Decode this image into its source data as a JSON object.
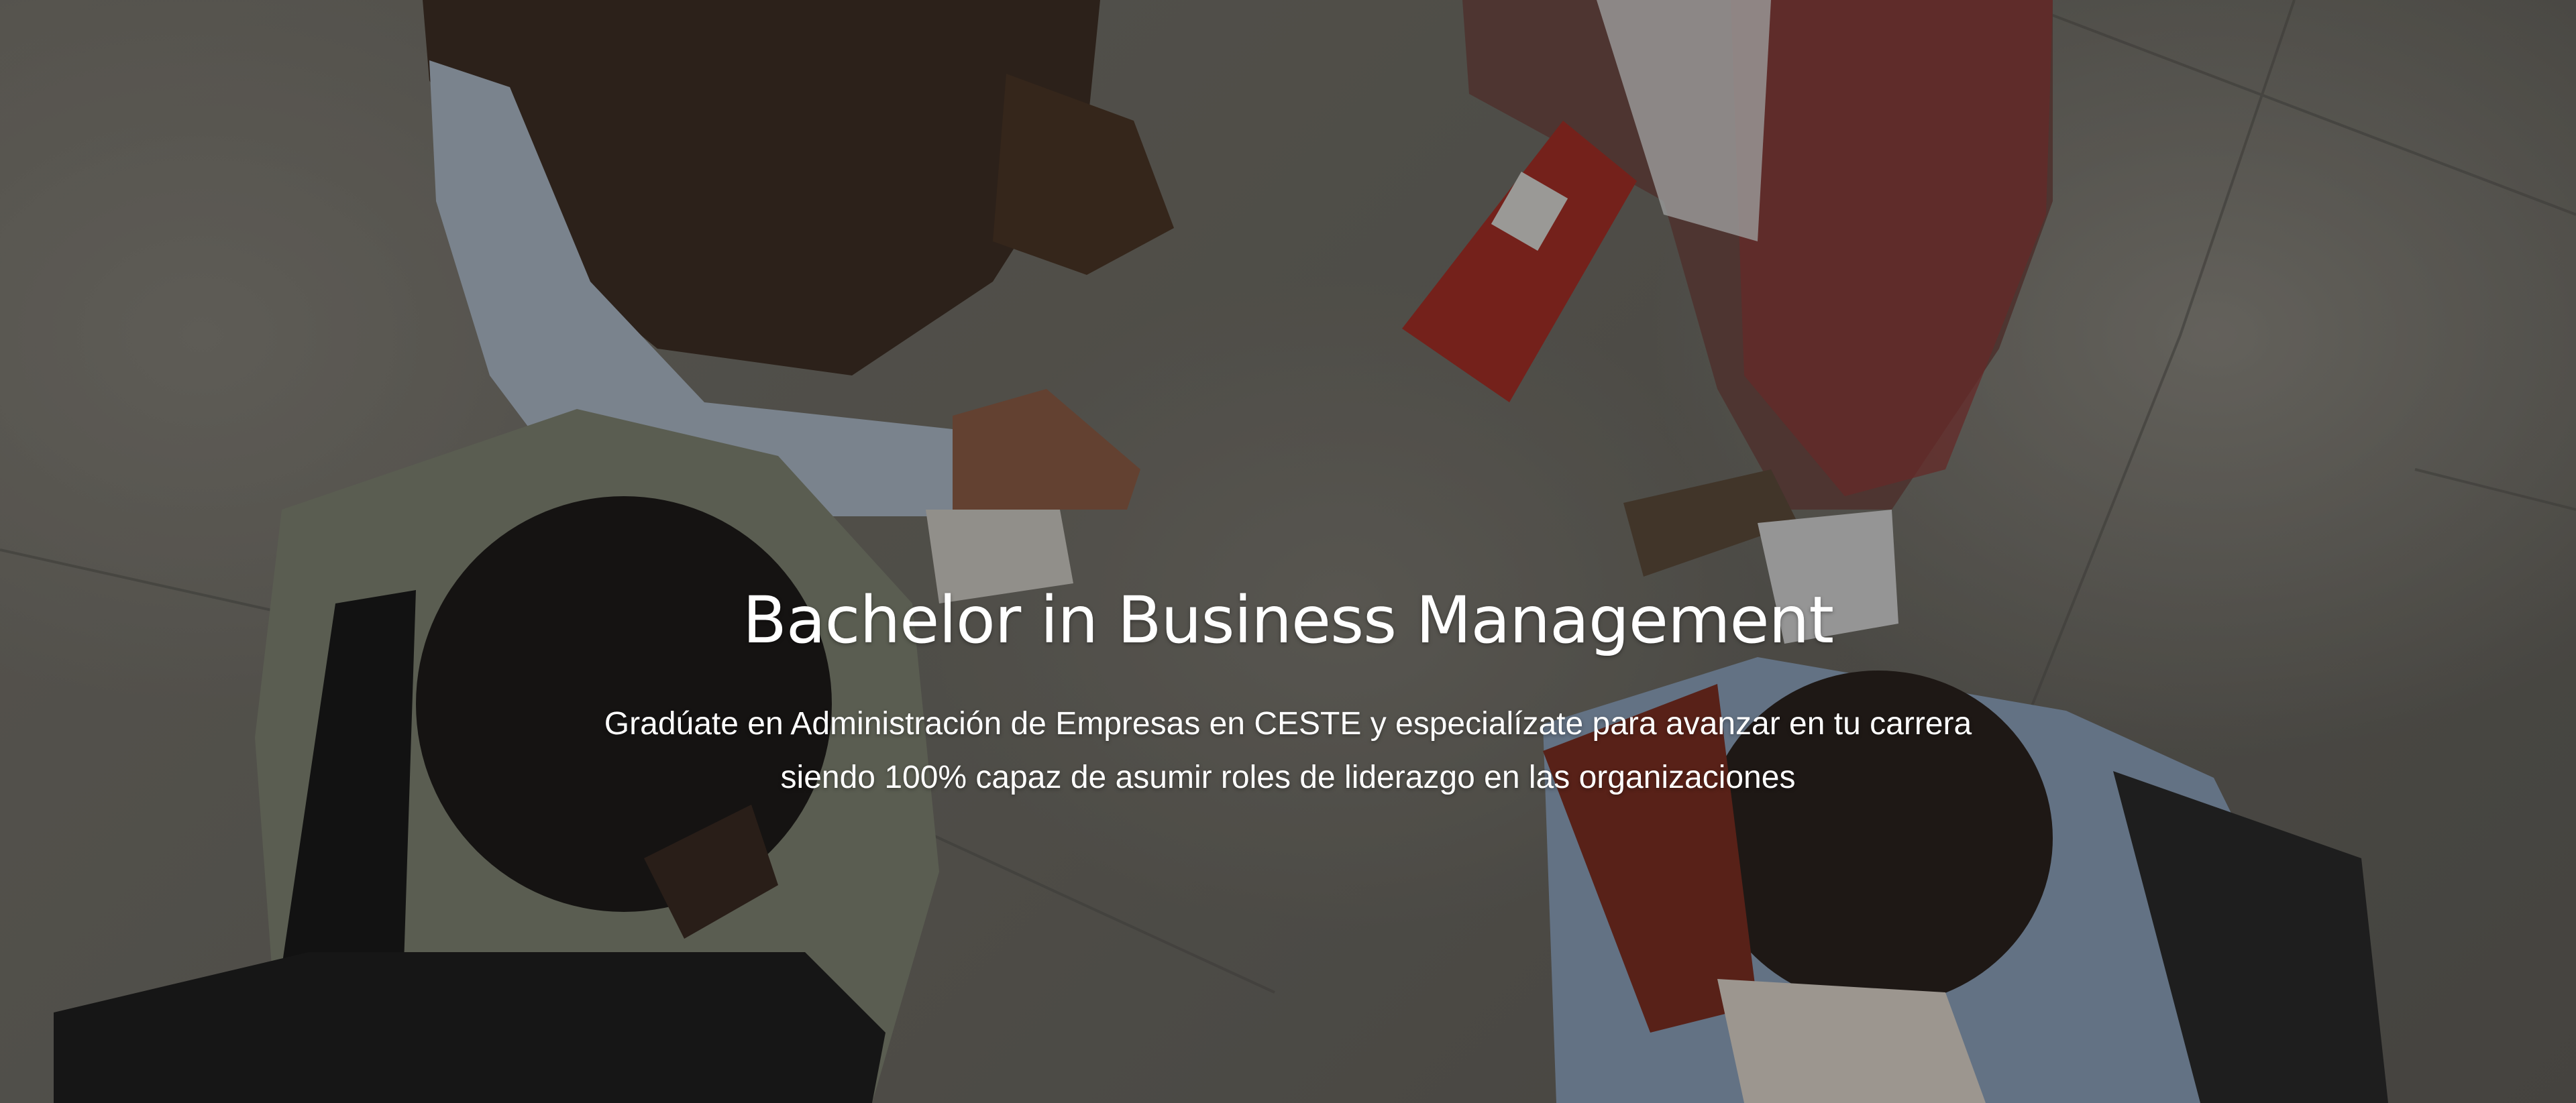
{
  "hero": {
    "title": "Bachelor in Business Management",
    "subtitle_line1": "Gradúate en Administración de Empresas en CESTE y especialízate para avanzar en tu carrera",
    "subtitle_line2": "siendo 100% capaz de asumir roles de liderazgo en las organizaciones",
    "background_image": "students-top-view-photo"
  },
  "colors": {
    "text": "#ffffff",
    "floor": "#77746c",
    "overlay": "rgba(0,0,0,0.28)"
  }
}
